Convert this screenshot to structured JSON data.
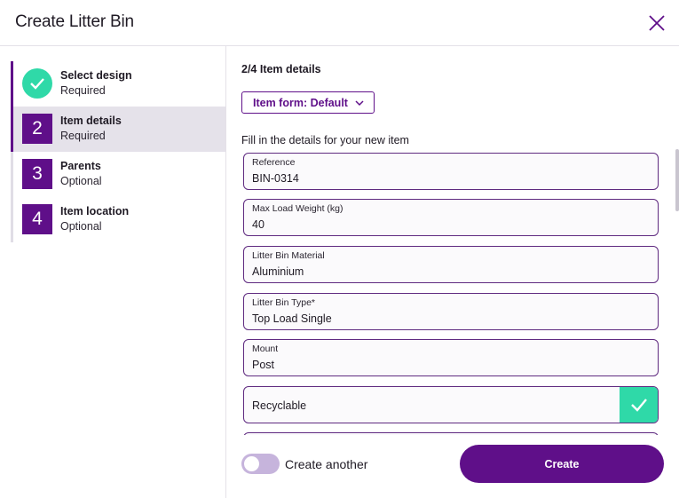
{
  "header": {
    "title": "Create Litter Bin"
  },
  "steps": [
    {
      "number": "",
      "name": "Select design",
      "status": "Required"
    },
    {
      "number": "2",
      "name": "Item details",
      "status": "Required"
    },
    {
      "number": "3",
      "name": "Parents",
      "status": "Optional"
    },
    {
      "number": "4",
      "name": "Item location",
      "status": "Optional"
    }
  ],
  "content": {
    "step_title": "2/4 Item details",
    "form_button": "Item form: Default",
    "instructions": "Fill in the details for your new item",
    "fields": [
      {
        "label": "Reference",
        "value": "BIN-0314"
      },
      {
        "label": "Max Load Weight (kg)",
        "value": "40"
      },
      {
        "label": "Litter Bin Material",
        "value": "Aluminium"
      },
      {
        "label": "Litter Bin Type*",
        "value": "Top Load Single"
      },
      {
        "label": "Mount",
        "value": "Post"
      }
    ],
    "checkbox": {
      "label": "Recyclable",
      "checked": true
    }
  },
  "footer": {
    "toggle_label": "Create another",
    "create_label": "Create"
  },
  "colors": {
    "accent": "#5f0f89",
    "success": "#2fd9a8"
  }
}
